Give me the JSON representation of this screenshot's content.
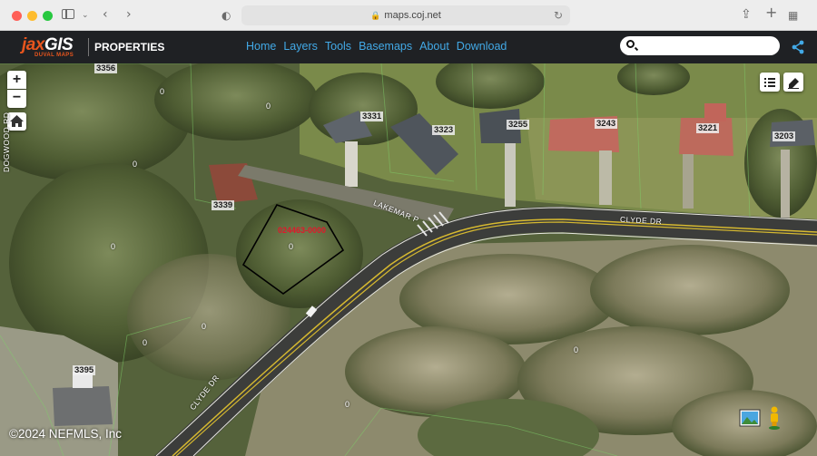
{
  "browser": {
    "url": "maps.coj.net"
  },
  "app": {
    "logo_text_left": "jax",
    "logo_text_right": "GIS",
    "logo_sub": "DUVAL MAPS",
    "product": "PROPERTIES",
    "nav": [
      "Home",
      "Layers",
      "Tools",
      "Basemaps",
      "About",
      "Download"
    ],
    "search_placeholder": "",
    "colors": {
      "header_bg": "#1f2124",
      "nav_link": "#42a9e6",
      "logo_orange": "#e8551d",
      "parcel_id_red": "#e0182b"
    }
  },
  "map": {
    "zoom_in": "+",
    "zoom_out": "−",
    "house_numbers": [
      "3356",
      "3331",
      "3323",
      "3255",
      "3243",
      "3221",
      "3203",
      "3339",
      "3395"
    ],
    "parcel_id": "024463-0000",
    "zero_label": "0",
    "streets": {
      "dogwood": "DOGWOOD RD",
      "lakemar": "LAKEMAR P",
      "clyde_top": "CLYDE DR",
      "clyde_bottom": "CLYDE DR"
    },
    "watermark": "©2024 NEFMLS, Inc",
    "icons": [
      "plus-icon",
      "minus-icon",
      "home-icon",
      "list-icon",
      "eraser-icon",
      "image-gallery-icon",
      "street-view-pegman-icon"
    ]
  }
}
